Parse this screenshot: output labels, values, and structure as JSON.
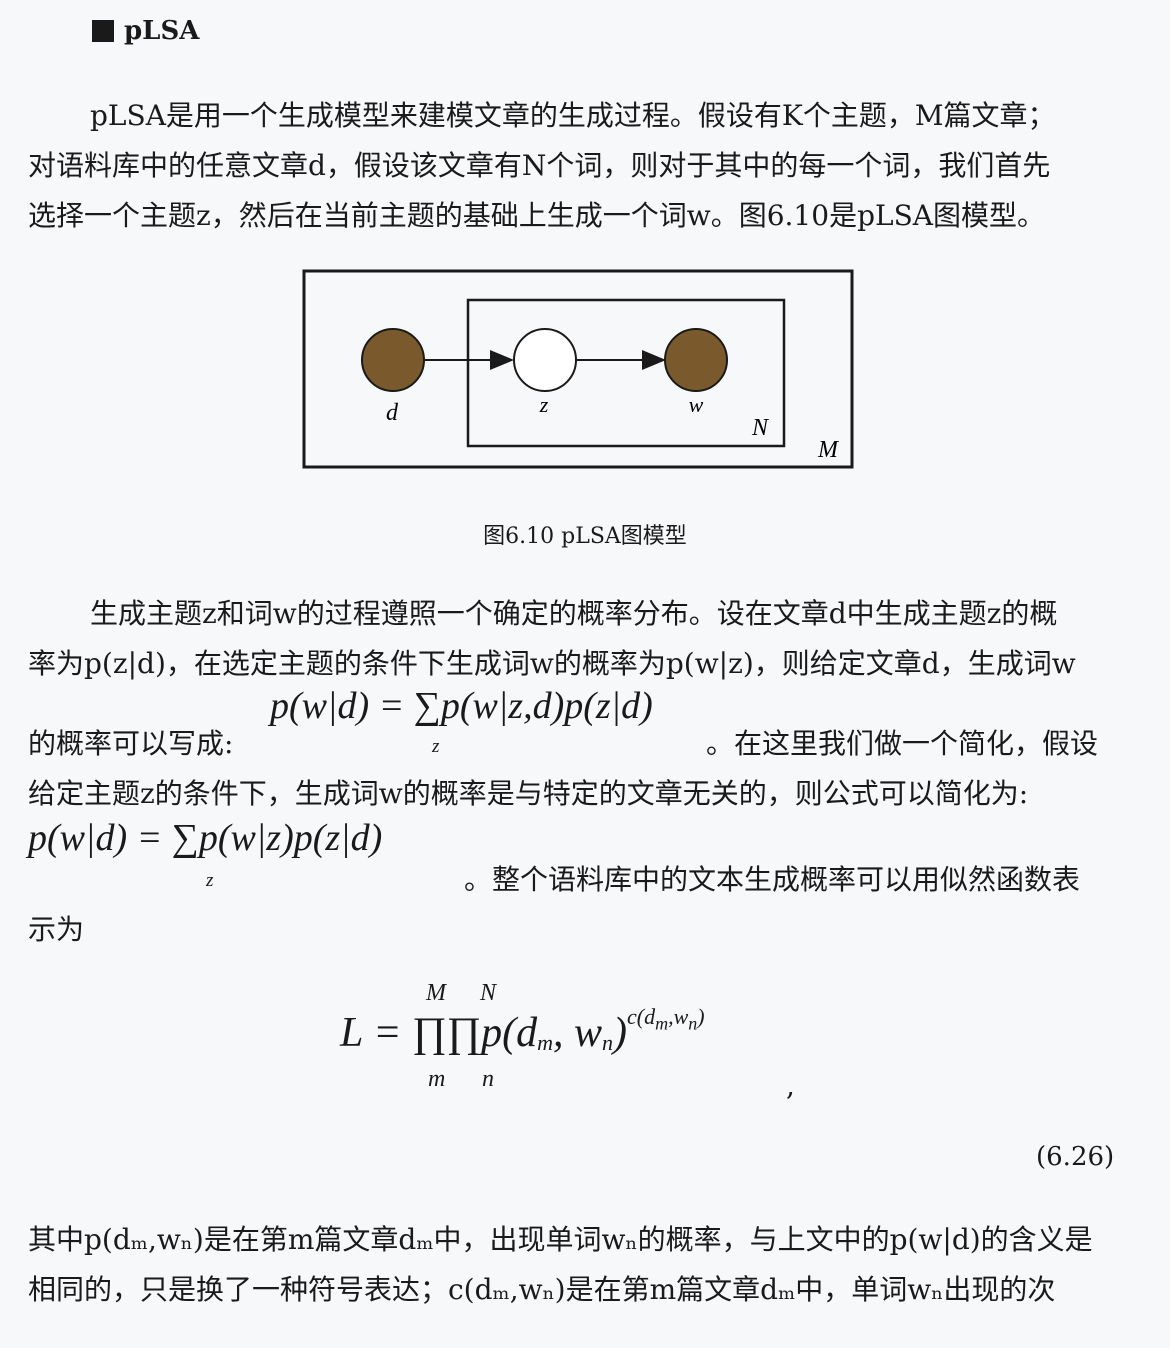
{
  "heading": "pLSA",
  "intro": {
    "line1": "pLSA是用一个生成模型来建模文章的生成过程。假设有K个主题，M篇文章；",
    "line2": "对语料库中的任意文章d，假设该文章有N个词，则对于其中的每一个词，我们首先",
    "line3": "选择一个主题z，然后在当前主题的基础上生成一个词w。图6.10是pLSA图模型。"
  },
  "figure": {
    "node_d": "d",
    "node_z": "z",
    "node_w": "w",
    "plate_inner": "N",
    "plate_outer": "M",
    "observed_color": "#7a5a2c",
    "caption": "图6.10    pLSA图模型"
  },
  "body": {
    "line1": "生成主题z和词w的过程遵照一个确定的概率分布。设在文章d中生成主题z的概",
    "line2": "率为p(z|d)，在选定主题的条件下生成词w的概率为p(w|z)，则给定文章d，生成词w",
    "eq1": "p(w|d) = ∑p(w|z,d)p(z|d)",
    "eq1_sub": "z",
    "line3a": "的概率可以写成:",
    "line3b": "。在这里我们做一个简化，假设",
    "line4": "给定主题z的条件下，生成词w的概率是与特定的文章无关的，则公式可以简化为:",
    "eq2": "p(w|d) = ∑p(w|z)p(z|d)",
    "eq2_sub": "z",
    "line5": "。整个语料库中的文本生成概率可以用似然函数表",
    "line6": "示为"
  },
  "likelihood": {
    "lhs": "L = ∏∏p(d",
    "sub_m": "m",
    "mid": ", w",
    "sub_n": "n",
    "close": ")",
    "exponent": "c(d",
    "exp_sub_m": "m",
    "exp_mid": ",w",
    "exp_sub_n": "n",
    "exp_close": ")",
    "upper_M": "M",
    "upper_N": "N",
    "lower_m": "m",
    "lower_n": "n",
    "comma": ",",
    "number": "(6.26)"
  },
  "footer": {
    "line1": "其中p(dₘ,wₙ)是在第m篇文章dₘ中，出现单词wₙ的概率，与上文中的p(w|d)的含义是",
    "line2": "相同的，只是换了一种符号表达；c(dₘ,wₙ)是在第m篇文章dₘ中，单词wₙ出现的次"
  }
}
